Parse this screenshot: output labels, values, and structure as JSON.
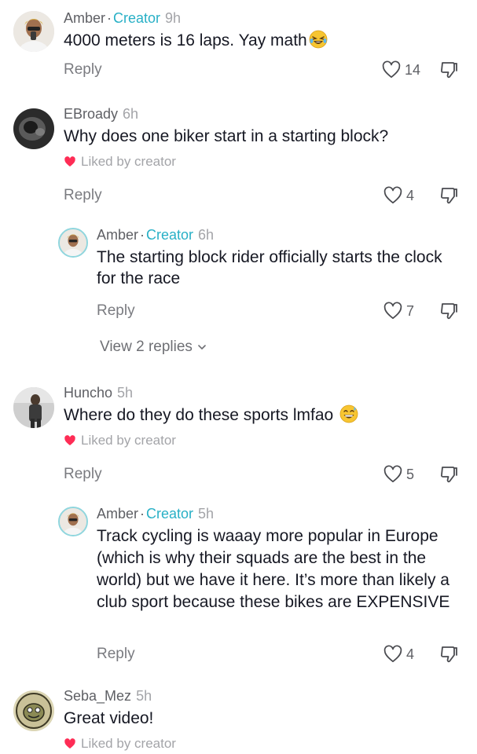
{
  "comments": [
    {
      "author": "Amber",
      "creator_badge": "Creator",
      "time": "9h",
      "text": "4000 meters is 16 laps. Yay math",
      "emoji": "grinning-squint-tears",
      "reply_label": "Reply",
      "likes": "14"
    },
    {
      "author": "EBroady",
      "time": "6h",
      "text": "Why does one biker start in a starting block?",
      "liked_by": "Liked by creator",
      "reply_label": "Reply",
      "likes": "4",
      "replies": [
        {
          "author": "Amber",
          "creator_badge": "Creator",
          "time": "6h",
          "text": "The starting block rider officially starts the clock for the race",
          "reply_label": "Reply",
          "likes": "7"
        }
      ],
      "view_replies": "View 2 replies"
    },
    {
      "author": "Huncho",
      "time": "5h",
      "text": "Where do they do these sports lmfao",
      "emoji": "grinning-sweat",
      "liked_by": "Liked by creator",
      "reply_label": "Reply",
      "likes": "5",
      "replies": [
        {
          "author": "Amber",
          "creator_badge": "Creator",
          "time": "5h",
          "text": "Track cycling is waaay more popular in Europe (which is why their squads are the best in the world) but we have it here. It’s more than likely a club sport because these bikes are EXPENSIVE",
          "reply_label": "Reply",
          "likes": "4"
        }
      ]
    },
    {
      "author": "Seba_Mez",
      "time": "5h",
      "text": "Great video!",
      "liked_by": "Liked by creator"
    }
  ],
  "colors": {
    "creator_accent": "#28b0c6",
    "liked_heart": "#fe2c55",
    "text_primary": "#161823",
    "text_secondary": "#5e5f64"
  }
}
